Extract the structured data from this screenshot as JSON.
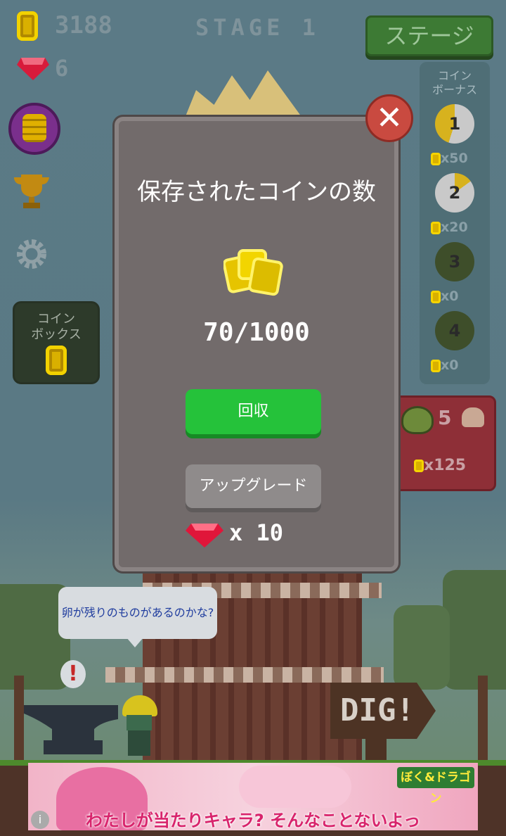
{
  "hud": {
    "coins": "3188",
    "gems": "6",
    "stage_label": "STAGE 1",
    "stage_button": "ステージ"
  },
  "coin_bonus": {
    "title_line1": "コイン",
    "title_line2": "ボーナス",
    "items": [
      {
        "num": "1",
        "amount": "x50"
      },
      {
        "num": "2",
        "amount": "x20"
      },
      {
        "num": "3",
        "amount": "x0"
      },
      {
        "num": "4",
        "amount": "x0"
      }
    ]
  },
  "coin_box": {
    "line1": "コイン",
    "line2": "ボックス"
  },
  "worker": {
    "count": "5",
    "cost": "x125"
  },
  "modal": {
    "title": "保存されたコインの数",
    "count": "70/1000",
    "collect_label": "回収",
    "upgrade_label": "アップグレード",
    "gem_cost": "x 10"
  },
  "speech": "卵が残りのものがあるのかな?",
  "dig_sign": "DIG!",
  "ad": {
    "logo": "ぼく&ドラゴン",
    "text": "わたしが当たりキャラ? そんなことないよっ"
  },
  "colors": {
    "green_button": "#25c23a",
    "close_red": "#c94a40",
    "modal_bg": "#726b6b"
  }
}
